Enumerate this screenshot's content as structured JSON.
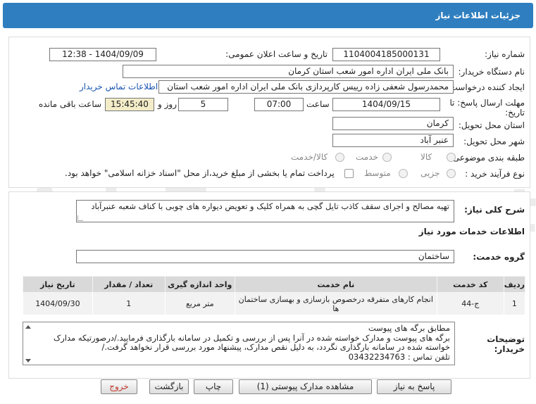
{
  "header": {
    "title": "جزئیات اطلاعات نیاز"
  },
  "fields": {
    "need_number_label": "شماره نیاز:",
    "need_number": "1104004185000131",
    "announce_label": "تاریخ و ساعت اعلان عمومی:",
    "announce_value": "1404/09/09 - 12:38",
    "buyer_org_label": "نام دستگاه خریدار:",
    "buyer_org": "بانک ملی ایران اداره امور شعب استان کرمان",
    "creator_label": "ایجاد کننده درخواست:",
    "creator": "محمدرسول شعفی زاده رییس کارپردازی بانک ملی ایران اداره امور شعب استان",
    "contact_link": "اطلاعات تماس خریدار",
    "deadline_label_1": "مهلت ارسال پاسخ: تا",
    "deadline_label_2": "تاریخ:",
    "deadline_date": "1404/09/15",
    "time_label": "ساعت",
    "deadline_time": "07:00",
    "days_value": "5",
    "days_label": "روز و",
    "remaining_time": "15:45:40",
    "remaining_label": "ساعت باقی مانده",
    "province_label": "استان محل تحویل:",
    "province": "کرمان",
    "city_label": "شهر محل تحویل:",
    "city": "عنبر آباد",
    "category_label": "طبقه بندی موضوعی:",
    "category_options": [
      "کالا",
      "خدمت",
      "کالا/خدمت"
    ],
    "purchase_type_label": "نوع فرآیند خرید :",
    "purchase_options": [
      "جزیی",
      "متوسط"
    ],
    "purchase_note": "پرداخت تمام یا بخشی از مبلغ خرید،از محل \"اسناد خزانه اسلامی\" خواهد بود."
  },
  "summary": {
    "label": "شرح کلی نیاز:",
    "text": "تهیه مصالح و اجرای سقف کاذب تایل گچی به همراه کلیک و تعویض دیواره های چوبی با کناف شعبه عنبرآباد"
  },
  "services": {
    "title": "اطلاعات خدمات مورد نیاز",
    "group_label": "گروه خدمت:",
    "group_value": "ساختمان",
    "columns": [
      "ردیف",
      "کد خدمت",
      "نام خدمت",
      "واحد اندازه گیری",
      "تعداد / مقدار",
      "تاریخ نیاز"
    ],
    "rows": [
      [
        "1",
        "ج-44",
        "انجام کارهای متفرقه درخصوص بازسازی و بهسازی ساختمان ها",
        "متر مربع",
        "1",
        "1404/09/30"
      ]
    ]
  },
  "buyer_notes": {
    "label_1": "توضیحات",
    "label_2": "خریدار:",
    "lines": [
      "مطابق برگه های پیوست",
      "برگه های پیوست و مدارک خواسته شده در آنرا پس از بررسی و تکمیل در سامانه بارگذاری فرمایید./درصورتیکه مدارک",
      "خواسته شده در سامانه بارگذاری نگردد، به دلیل نقص مدارک، پیشنهاد مورد بررسی قرار نخواهد گرفت./",
      "تلفن تماس : 03432234763"
    ]
  },
  "buttons": {
    "reply": "پاسخ به نیاز",
    "attachments": "مشاهده مدارک پیوستی (1)",
    "print": "چاپ",
    "back": "بازگشت",
    "exit": "خروج"
  },
  "watermark": "AriaTender.net",
  "colors": {
    "header": "#2f7fc0",
    "link": "#1a55b0",
    "exit_text": "#c0392b"
  }
}
